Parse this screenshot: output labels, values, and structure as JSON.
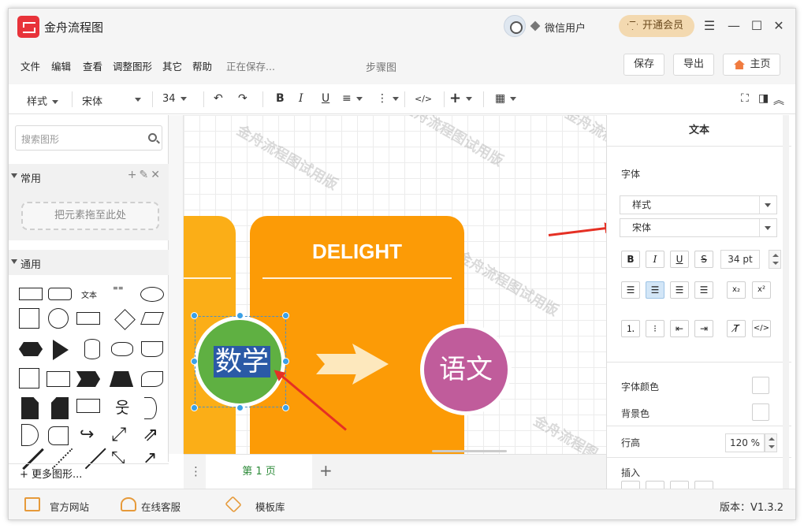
{
  "app": {
    "title": "金舟流程图",
    "username": "微信用户",
    "vip_button": "开通会员"
  },
  "menu": {
    "items": [
      "文件",
      "编辑",
      "查看",
      "调整图形",
      "其它",
      "帮助"
    ],
    "status": "正在保存...",
    "document_title": "步骤图",
    "save": "保存",
    "export": "导出",
    "home": "主页"
  },
  "toolbar": {
    "style": "样式",
    "font": "宋体",
    "size": "34",
    "code": "</>"
  },
  "sidebar": {
    "search_placeholder": "搜索图形",
    "section_common": "常用",
    "drop_hint": "把元素拖至此处",
    "section_general": "通用",
    "text_shape": "文本",
    "more_shapes": "更多图形..."
  },
  "canvas": {
    "watermark": "金舟流程图试用版",
    "watermark_short": "金舟流程图",
    "card_title": "DELIGHT",
    "circle_math": "数学",
    "circle_lang": "语文"
  },
  "pages": {
    "current": "第 1 页"
  },
  "panel": {
    "title": "文本",
    "font_label": "字体",
    "style_select": "样式",
    "font_select": "宋体",
    "font_size": "34 pt",
    "font_color": "字体颜色",
    "bg_color": "背景色",
    "line_height_label": "行高",
    "line_height": "120 %",
    "insert_label": "插入",
    "bold": "B",
    "italic": "I",
    "underline": "U",
    "strike": "S"
  },
  "bottom": {
    "website": "官方网站",
    "support": "在线客服",
    "templates": "模板库",
    "version": "版本：V1.3.2"
  },
  "colors": {
    "accent_red": "#e8333a",
    "card_orange": "#fc9b06",
    "card_yellow": "#fbae17",
    "circle_green": "#5fb042",
    "circle_purple": "#c05c9b",
    "page_tab_green": "#2e8b3a"
  }
}
